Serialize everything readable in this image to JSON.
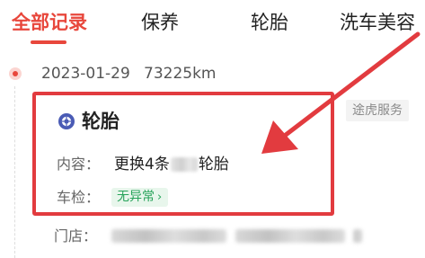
{
  "tabs": [
    {
      "label": "全部记录",
      "active": true
    },
    {
      "label": "保养",
      "active": false
    },
    {
      "label": "轮胎",
      "active": false
    },
    {
      "label": "洗车美容",
      "active": false
    }
  ],
  "record": {
    "date": "2023-01-29",
    "km": "73225km",
    "service_tag": "途虎服务",
    "title": "轮胎",
    "title_icon": "tire-icon",
    "content_label": "内容：",
    "content_prefix": "更换4条",
    "content_suffix": "轮胎",
    "inspection_label": "车检：",
    "inspection_status": "无异常",
    "inspection_chevron": "›",
    "store_label": "门店："
  },
  "colors": {
    "accent": "#e8473c",
    "highlight_border": "#e23b3f",
    "status_green": "#27a35a",
    "status_green_bg": "#e8f6ec"
  }
}
